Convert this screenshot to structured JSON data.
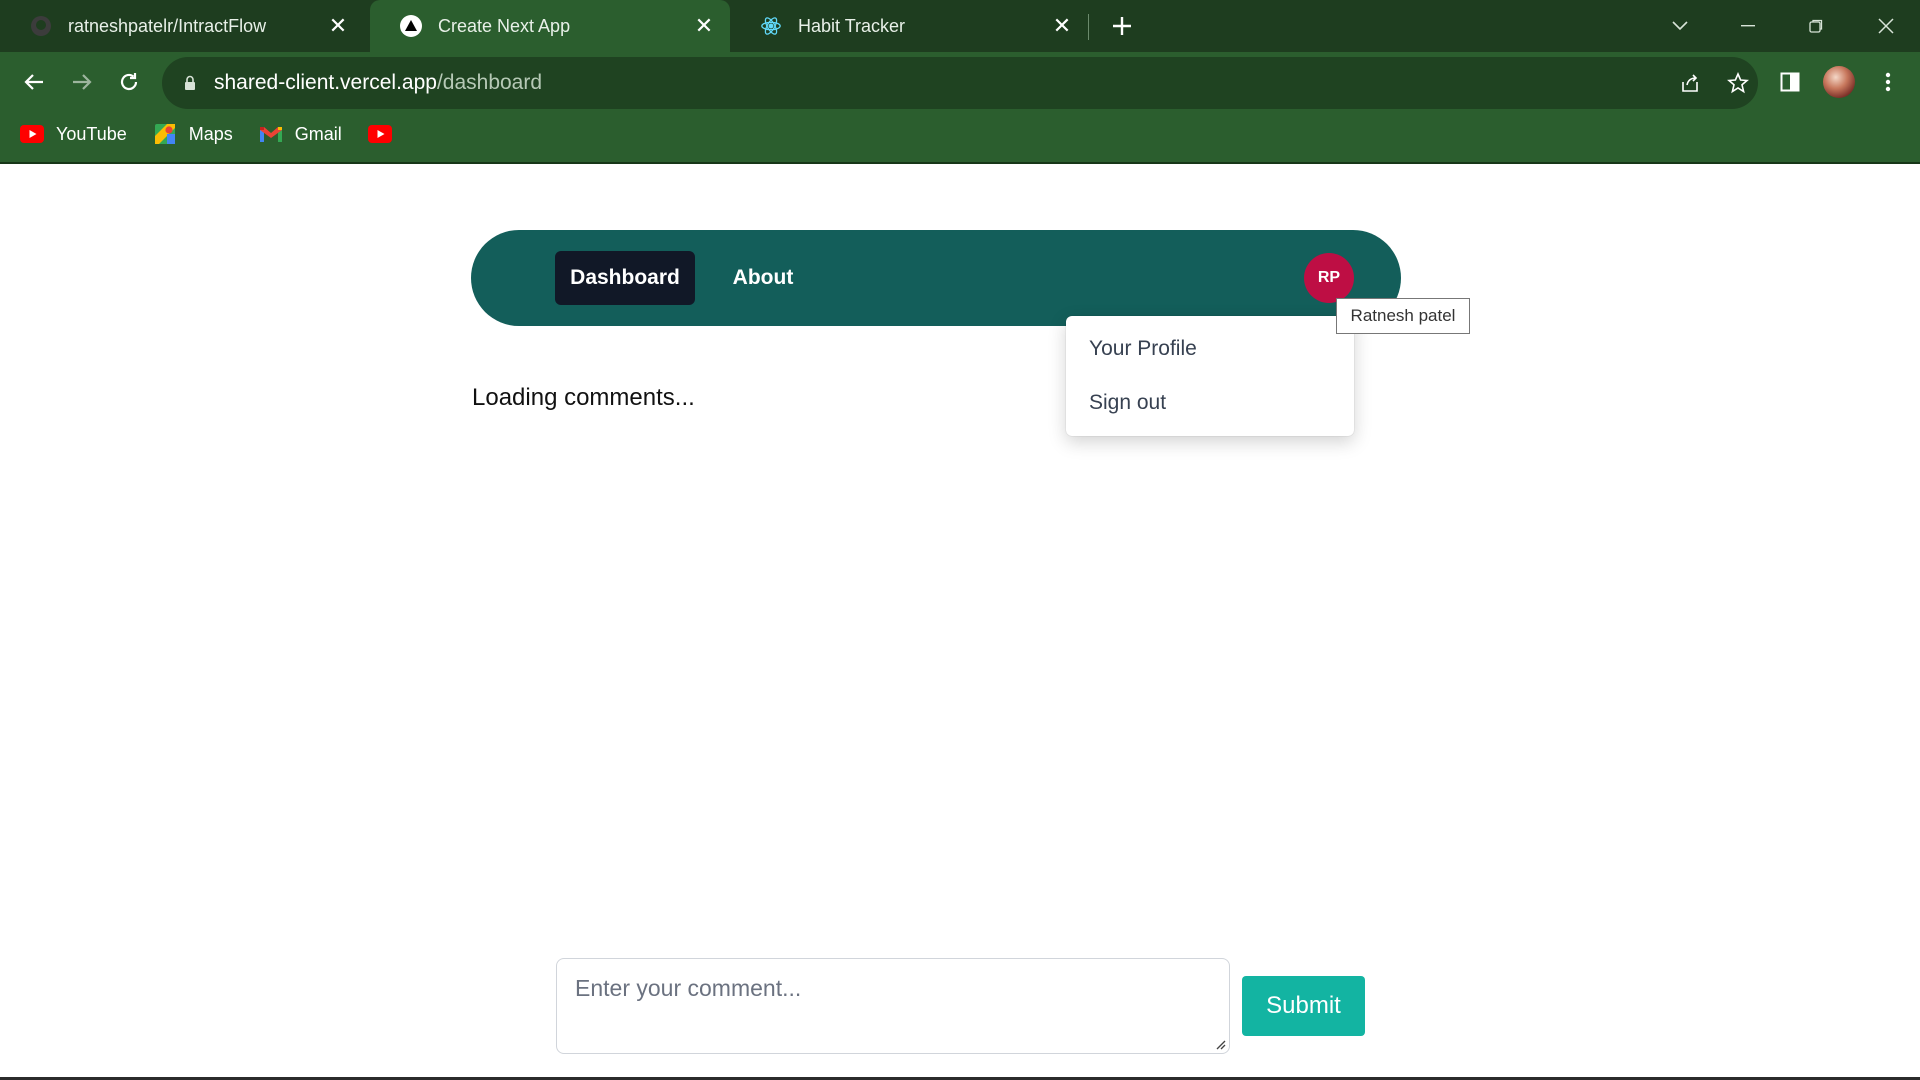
{
  "browser": {
    "tabs": [
      {
        "title": "ratneshpatelr/IntractFlow",
        "icon": "github-icon",
        "active": false
      },
      {
        "title": "Create Next App",
        "icon": "nextjs-icon",
        "active": true
      },
      {
        "title": "Habit Tracker",
        "icon": "react-icon",
        "active": false
      }
    ],
    "address_host": "shared-client.vercel.app",
    "address_path": "/dashboard",
    "bookmarks": [
      {
        "label": "YouTube",
        "icon": "youtube-icon"
      },
      {
        "label": "Maps",
        "icon": "maps-icon"
      },
      {
        "label": "Gmail",
        "icon": "gmail-icon"
      },
      {
        "label": "",
        "icon": "youtube-icon"
      }
    ],
    "colors": {
      "frame": "#2b5e2e",
      "tabstrip": "#1e3d1f"
    }
  },
  "navbar": {
    "links": [
      {
        "label": "Dashboard",
        "active": true
      },
      {
        "label": "About",
        "active": false
      }
    ],
    "avatar_initials": "RP",
    "avatar_tooltip": "Ratnesh patel",
    "colors": {
      "bar": "#135e5a",
      "active_link": "#111827",
      "avatar": "#be0e44"
    }
  },
  "user_menu": {
    "items": [
      "Your Profile",
      "Sign out"
    ]
  },
  "main": {
    "loading_text": "Loading comments..."
  },
  "comment_form": {
    "placeholder": "Enter your comment...",
    "value": "",
    "submit_label": "Submit",
    "submit_color": "#13b4a2"
  }
}
